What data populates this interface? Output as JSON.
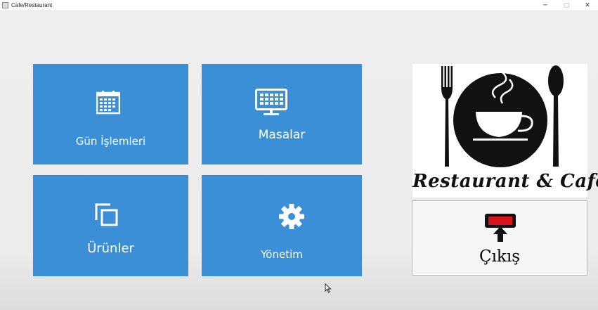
{
  "window": {
    "title": "Cafe/Restaurant",
    "minimize_symbol": "─",
    "maximize_symbol": "▢",
    "close_symbol": "✕"
  },
  "tiles": [
    {
      "label": "Gün İşlemleri",
      "icon": "calendar-icon"
    },
    {
      "label": "Masalar",
      "icon": "monitor-grid-icon"
    },
    {
      "label": "Ürünler",
      "icon": "copy-icon"
    },
    {
      "label": "Yönetim",
      "icon": "gear-icon"
    }
  ],
  "logo": {
    "text": "Restaurant & Cafe"
  },
  "exit": {
    "label": "Çıkış",
    "icon": "exit-monitor-icon"
  },
  "colors": {
    "tile": "#3a8fd6",
    "tile_text": "#ffffff",
    "logo_ink": "#111111"
  }
}
